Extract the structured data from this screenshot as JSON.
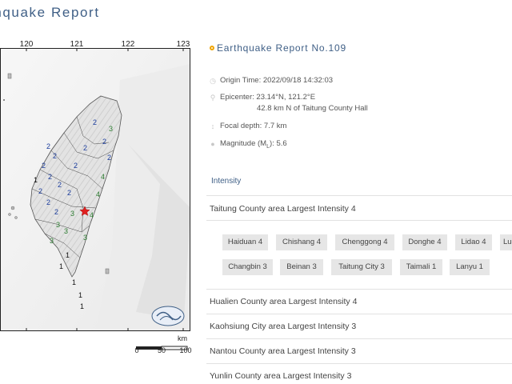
{
  "page": {
    "title": "thquake Report"
  },
  "map": {
    "longitudes": [
      "120",
      "121",
      "122",
      "123"
    ],
    "scale": {
      "unit": "km",
      "ticks": [
        "0",
        "50",
        "100"
      ]
    },
    "station_intensities": [
      "2",
      "2",
      "2",
      "2",
      "2",
      "2",
      "2",
      "2",
      "2",
      "2",
      "3",
      "3",
      "3",
      "3",
      "3",
      "4",
      "4",
      "4",
      "1",
      "1",
      "1",
      "1",
      "1",
      "2",
      "2",
      "3",
      "2",
      "2",
      "1"
    ]
  },
  "report": {
    "title": "Earthquake Report No.109",
    "origin_time": "Origin Time: 2022/09/18 14:32:03",
    "epicenter": "Epicenter: 23.14°N, 121.2°E",
    "epicenter_detail": "42.8 km N of Taitung County Hall",
    "focal_depth": "Focal depth: 7.7 km",
    "magnitude_prefix": "Magnitude (M",
    "magnitude_sub": "L",
    "magnitude_suffix": "): 5.6"
  },
  "intensity": {
    "label": "Intensity",
    "areas": [
      {
        "title": "Taitung County area Largest Intensity 4"
      },
      {
        "title": "Hualien County area Largest Intensity 4"
      },
      {
        "title": "Kaohsiung City area Largest Intensity 3"
      },
      {
        "title": "Nantou County area Largest Intensity 3"
      },
      {
        "title": "Yunlin County area Largest Intensity 3"
      }
    ],
    "taitung_stations_row1": [
      "Haiduan 4",
      "Chishang 4",
      "Chenggong 4",
      "Donghe 4",
      "Lidao 4",
      "Lu"
    ],
    "taitung_stations_row2": [
      "Changbin 3",
      "Beinan 3",
      "Taitung City 3",
      "Taimali 1",
      "Lanyu 1"
    ]
  },
  "colors": {
    "accent": "#3f5f86",
    "marker": "#f0a500",
    "chip_bg": "#e6e6e6",
    "epicenter": "#e02020"
  }
}
